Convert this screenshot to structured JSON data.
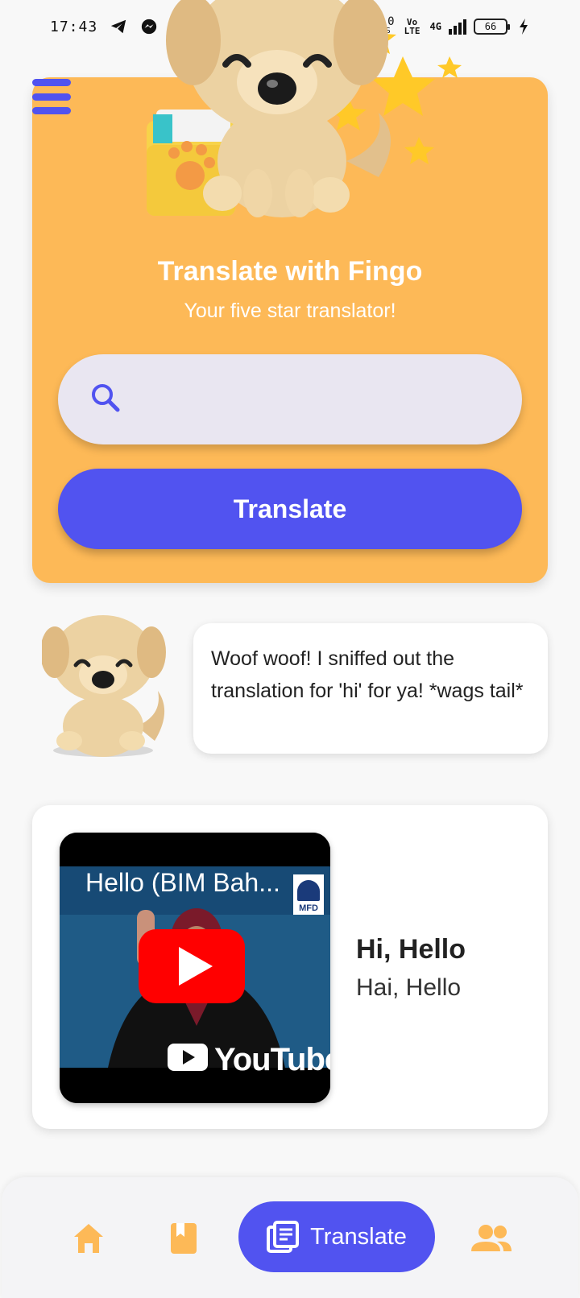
{
  "status_bar": {
    "time": "17:43",
    "network_speed": "49.0",
    "network_speed_unit": "KB/S",
    "volte": "Vo LTE",
    "signal": "4G",
    "battery": "66"
  },
  "hero": {
    "title": "Translate with Fingo",
    "subtitle": "Your five star translator!",
    "search_placeholder": "",
    "search_value": "",
    "translate_label": "Translate"
  },
  "mascot": {
    "message": "Woof woof! I sniffed out the translation for 'hi' for ya! *wags tail*"
  },
  "result": {
    "video_title": "Hello (BIM Bah...",
    "video_brand": "YouTube",
    "channel_logo_text": "MFD",
    "english": "Hi, Hello",
    "malay": "Hai, Hello"
  },
  "bottom_nav": {
    "items": [
      {
        "icon": "home-icon",
        "label": ""
      },
      {
        "icon": "book-icon",
        "label": ""
      },
      {
        "icon": "translate-icon",
        "label": "Translate",
        "active": true
      },
      {
        "icon": "people-icon",
        "label": ""
      }
    ]
  },
  "colors": {
    "accent": "#5153f0",
    "hero_bg": "#fdb957",
    "nav_icon": "#fdb957"
  }
}
